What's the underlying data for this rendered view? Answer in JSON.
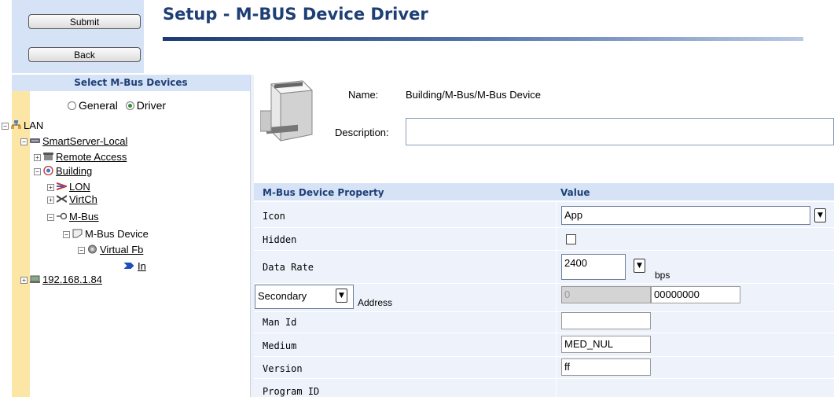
{
  "header": {
    "submit_label": "Submit",
    "back_label": "Back",
    "title": "Setup - M-BUS Device Driver"
  },
  "left": {
    "heading": "Select M-Bus Devices",
    "radio_general": "General",
    "radio_driver": "Driver",
    "selected_radio": "Driver",
    "tree": {
      "lan": "LAN",
      "smartserver": "SmartServer-Local",
      "remote_access": "Remote Access",
      "building": "Building",
      "lon": "LON",
      "virtch": "VirtCh",
      "mbus": "M-Bus",
      "mbus_device": "M-Bus Device",
      "virtual_fb": "Virtual Fb",
      "in": "In",
      "ip": "192.168.1.84"
    }
  },
  "device": {
    "name_label": "Name:",
    "name_value": "Building/M-Bus/M-Bus Device",
    "description_label": "Description:",
    "description_value": ""
  },
  "table": {
    "col_property": "M-Bus Device Property",
    "col_value": "Value",
    "rows": {
      "icon": {
        "label": "Icon",
        "value": "App"
      },
      "hidden": {
        "label": "Hidden",
        "checked": false
      },
      "data_rate": {
        "label": "Data Rate",
        "value": "2400",
        "unit": "bps"
      },
      "address": {
        "mode": "Secondary",
        "label": "Address",
        "primary": "0",
        "secondary": "00000000"
      },
      "man_id": {
        "label": "Man Id",
        "value": ""
      },
      "medium": {
        "label": "Medium",
        "value": "MED_NUL"
      },
      "version": {
        "label": "Version",
        "value": "ff"
      },
      "program_id": {
        "label": "Program ID"
      }
    }
  },
  "colors": {
    "title": "#1e3f75",
    "header_bg": "#d6e3f7",
    "row_bg": "#eef3fb",
    "strip": "#fbe6a6"
  }
}
